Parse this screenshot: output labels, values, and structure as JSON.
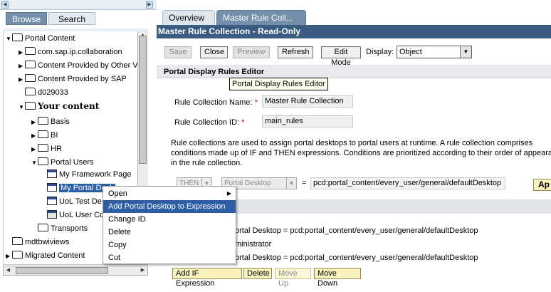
{
  "left_panel": {
    "tabs": {
      "browse": "Browse",
      "search": "Search"
    },
    "tree": {
      "portal_content": "Portal Content",
      "items": {
        "collaboration": "com.sap.ip.collaboration",
        "other_vendors": "Content Provided by Other Ve",
        "sap": "Content Provided by SAP",
        "d029033": "d029033",
        "your_content": "Your content",
        "basis": "Basis",
        "bi": "BI",
        "hr": "HR",
        "portal_users": "Portal Users",
        "my_framework_page": "My Framework Page",
        "my_portal_desktop": "My Portal Desk",
        "uol_test_desktop": "UoL Test De",
        "uol_user_content": "UoL User Co",
        "transports": "Transports",
        "mdtbwiviews": "mdtbwiviews",
        "migrated_content": "Migrated Content"
      }
    }
  },
  "right_panel": {
    "tabs": {
      "overview": "Overview",
      "master": "Master Rule Coll..."
    },
    "title": "Master Rule Collection - Read-Only",
    "toolbar": {
      "save": "Save",
      "close": "Close",
      "preview": "Preview",
      "refresh": "Refresh",
      "edit_mode": "Edit Mode",
      "display_label": "Display:",
      "display_value": "Object"
    },
    "editor": {
      "header": "Portal Display Rules Editor",
      "tooltip": "Portal Display Rules Editor",
      "name_label": "Rule Collection Name:",
      "name_value": "Master Rule Collection",
      "id_label": "Rule Collection ID:",
      "id_value": "main_rules",
      "required_mark": "*",
      "description_line1": "Rule collections are used to assign portal desktops to portal users at runtime. A rule collection comprises",
      "description_line2": "conditions made up of IF and THEN expressions. Conditions are prioritized according to their order of appearan",
      "description_line3": "in the rule collection.",
      "then_value": "THEN",
      "target_value": "Portal Desktop",
      "equals": "=",
      "path_value": "pcd:portal_content/every_user/general/defaultDesktop",
      "apply_label": "Ap",
      "rule_line1": "ortal Desktop = pcd:portal_content/every_user/general/defaultDesktop",
      "rule_line2": "ministrator",
      "rule_line3": "ortal Desktop = pcd:portal_content/every_user/general/defaultDesktop"
    },
    "bottom_buttons": {
      "add_if": "Add IF Expression",
      "delete": "Delete",
      "move_up": "Move Up",
      "move_down": "Move Down"
    }
  },
  "context_menu": {
    "items": [
      "Open",
      "Add Portal Desktop to Expression",
      "Change ID",
      "Delete",
      "Copy",
      "Cut"
    ],
    "highlight_color": "#2d5fa6"
  },
  "colors": {
    "title_bar": "#3a5b82",
    "active_tab": "#738fac",
    "button_yellow": "#f9f2bf"
  }
}
